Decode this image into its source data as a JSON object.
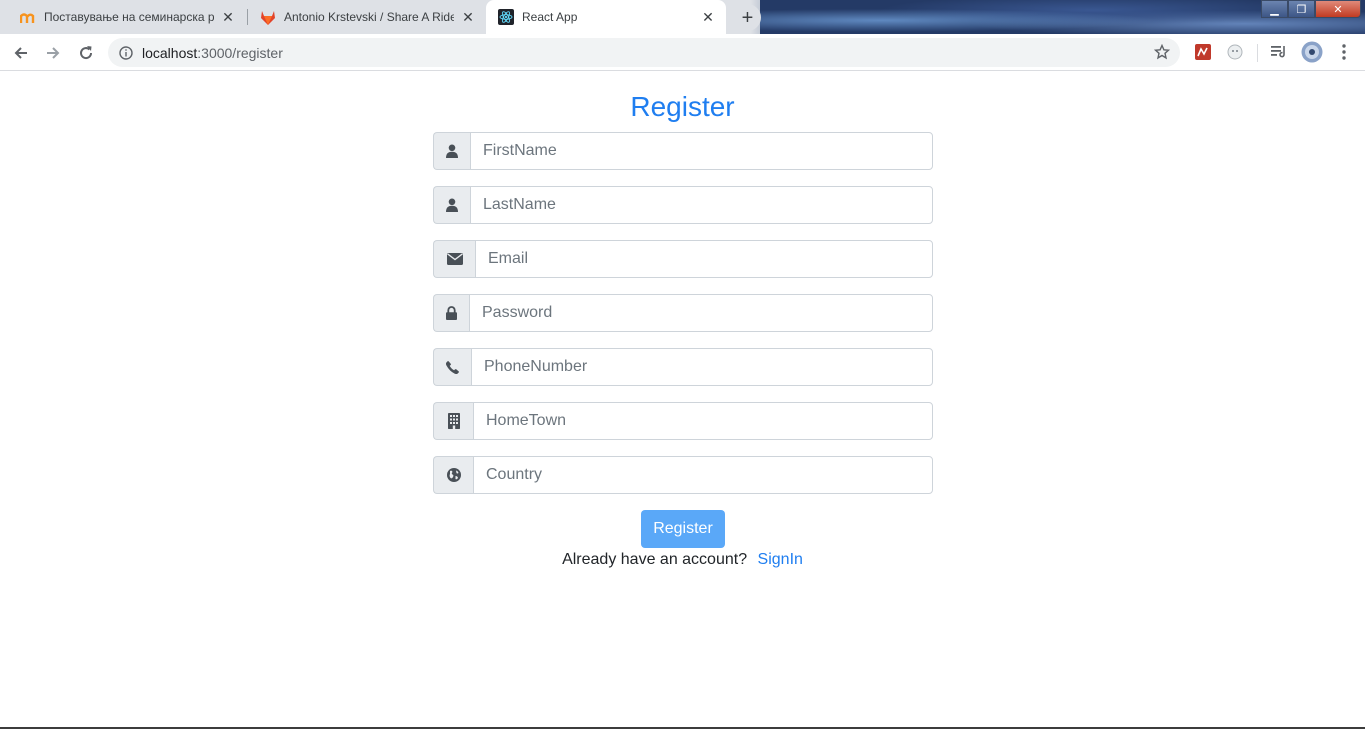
{
  "browser": {
    "tabs": [
      {
        "title": "Поставување на семинарска ра",
        "active": false
      },
      {
        "title": "Antonio Krstevski / Share A Ride",
        "active": false
      },
      {
        "title": "React App",
        "active": true
      }
    ],
    "url_host": "localhost",
    "url_path": ":3000/register"
  },
  "page": {
    "title": "Register",
    "fields": [
      {
        "icon": "user-icon",
        "placeholder": "FirstName"
      },
      {
        "icon": "user-icon",
        "placeholder": "LastName"
      },
      {
        "icon": "envelope-icon",
        "placeholder": "Email"
      },
      {
        "icon": "lock-icon",
        "placeholder": "Password"
      },
      {
        "icon": "phone-icon",
        "placeholder": "PhoneNumber"
      },
      {
        "icon": "building-icon",
        "placeholder": "HomeTown"
      },
      {
        "icon": "globe-icon",
        "placeholder": "Country"
      }
    ],
    "submit_label": "Register",
    "footer_text": "Already have an account?",
    "footer_link": "SignIn"
  },
  "colors": {
    "accent": "#1f7ef0",
    "button": "#5aa8f8",
    "addon_bg": "#e9ecef",
    "border": "#ced4da"
  }
}
